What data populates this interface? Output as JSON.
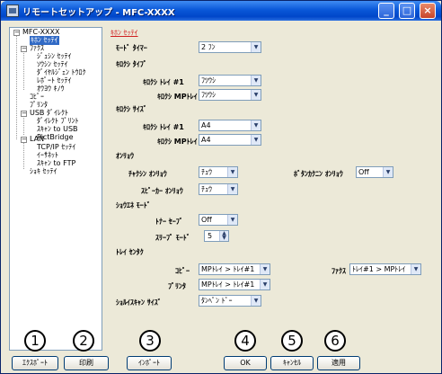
{
  "window": {
    "title": "リモートセットアップ - MFC-XXXX",
    "minimize_glyph": "_",
    "maximize_glyph": "□",
    "close_glyph": "×"
  },
  "tree": {
    "items": [
      {
        "label": "MFC-XXXX",
        "toggle": "−"
      },
      {
        "label": "ｷﾎﾝ ｾｯﾃｲ",
        "selected": true
      },
      {
        "label": "ﾌｧｸｽ",
        "toggle": "−"
      },
      {
        "label": "ｼﾞｭｼﾝ ｾｯﾃｲ"
      },
      {
        "label": "ｿｳｼﾝ ｾｯﾃｲ"
      },
      {
        "label": "ﾀﾞｲﾔﾙｼﾞｪﾝ ﾄｳﾛｸ"
      },
      {
        "label": "ﾚﾎﾟｰﾄ ｾｯﾃｲ"
      },
      {
        "label": "ｵｳﾖｳ ｷﾉｳ"
      },
      {
        "label": "ｺﾋﾟｰ"
      },
      {
        "label": "ﾌﾟﾘﾝﾀ"
      },
      {
        "label": "USB ﾀﾞｲﾚｸﾄ",
        "toggle": "−"
      },
      {
        "label": "ﾀﾞｲﾚｸﾄ ﾌﾟﾘﾝﾄ"
      },
      {
        "label": "ｽｷｬﾝ to USB"
      },
      {
        "label": "PictBridge"
      },
      {
        "label": "LAN",
        "toggle": "−"
      },
      {
        "label": "TCP/IP ｾｯﾃｲ"
      },
      {
        "label": "ｲｰｻﾈｯﾄ"
      },
      {
        "label": "ｽｷｬﾝ to FTP"
      },
      {
        "label": "ｼｮｷ ｾｯﾃｲ"
      }
    ]
  },
  "panel": {
    "title": "ｷﾎﾝ ｾｯﾃｲ",
    "mode_timer": {
      "label": "ﾓｰﾄﾞ ﾀｲﾏｰ",
      "value": "2 ﾌﾝ"
    },
    "paper_type": {
      "heading": "ｷﾛｸｼ ﾀｲﾌﾟ",
      "tray1_label": "ｷﾛｸｼ ﾄﾚｲ #1",
      "tray1_value": "ﾌﾂｳｼ",
      "mp_label": "ｷﾛｸｼ MPﾄﾚｲ",
      "mp_value": "ﾌﾂｳｼ"
    },
    "paper_size": {
      "heading": "ｷﾛｸｼ ｻｲｽﾞ",
      "tray1_label": "ｷﾛｸｼ ﾄﾚｲ #1",
      "tray1_value": "A4",
      "mp_label": "ｷﾛｸｼ MPﾄﾚｲ",
      "mp_value": "A4"
    },
    "volume": {
      "heading": "ｵﾝﾘｮｳ",
      "ring_label": "ﾁｬｸｼﾝ ｵﾝﾘｮｳ",
      "ring_value": "ﾁｭｳ",
      "beep_label": "ﾎﾞﾀﾝｶｸﾆﾝ ｵﾝﾘｮｳ",
      "beep_value": "Off",
      "speaker_label": "ｽﾋﾟｰｶｰ ｵﾝﾘｮｳ",
      "speaker_value": "ﾁｭｳ"
    },
    "eco": {
      "heading": "ｼｮｳｴﾈ ﾓｰﾄﾞ",
      "toner_label": "ﾄﾅｰ ｾｰﾌﾞ",
      "toner_value": "Off",
      "sleep_label": "ｽﾘｰﾌﾟ ﾓｰﾄﾞ",
      "sleep_value": "5"
    },
    "tray_use": {
      "heading": "ﾄﾚｲ ｾﾝﾀｸ",
      "copy_label": "ｺﾋﾟｰ",
      "copy_value": "MPﾄﾚｲ > ﾄﾚｲ#1",
      "fax_label": "ﾌｧｸｽ",
      "fax_value": "ﾄﾚｲ#1 > MPﾄﾚｲ",
      "print_label": "ﾌﾟﾘﾝﾀ",
      "print_value": "MPﾄﾚｲ > ﾄﾚｲ#1"
    },
    "doc_scan": {
      "label": "ｼｮﾙｲｽｷｬﾝ ｻｲｽﾞ",
      "value": "ﾀﾝﾍﾟﾝ ﾄﾞｰ"
    }
  },
  "buttons": {
    "export": "ｴｸｽﾎﾟｰﾄ",
    "print": "印刷",
    "import": "ｲﾝﾎﾟｰﾄ",
    "ok": "OK",
    "cancel": "ｷｬﾝｾﾙ",
    "apply": "適用"
  },
  "callouts": [
    "1",
    "2",
    "3",
    "4",
    "5",
    "6"
  ]
}
